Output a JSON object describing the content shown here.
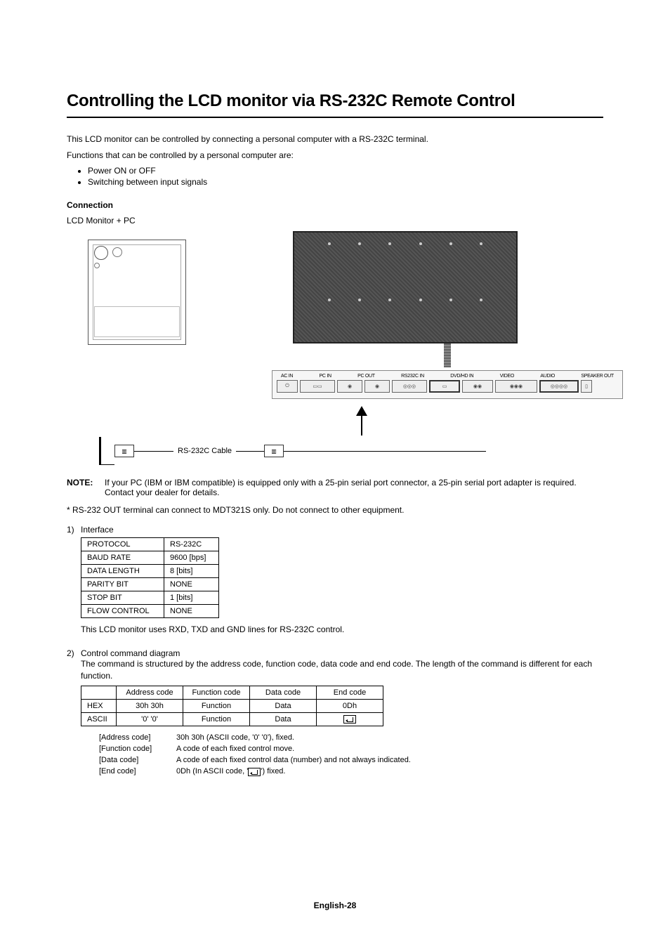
{
  "title": "Controlling the LCD monitor via RS-232C Remote Control",
  "intro1": "This LCD monitor can be controlled by connecting a personal computer with a RS-232C terminal.",
  "intro2": "Functions that can be controlled by a personal computer are:",
  "bullets": [
    "Power ON or OFF",
    "Switching between input signals"
  ],
  "connection": {
    "heading": "Connection",
    "subtitle": "LCD Monitor + PC",
    "cable_label": "RS-232C Cable",
    "panel_labels": [
      "AC IN",
      "PC IN",
      "PC OUT",
      "RS232C IN",
      "DVD/HD IN",
      "VIDEO",
      "AUDIO",
      "SPEAKER OUT"
    ]
  },
  "note": {
    "label": "NOTE:",
    "text": "If your PC (IBM or IBM compatible) is equipped only with a 25-pin serial port connector, a 25-pin serial port adapter is required. Contact your dealer for details."
  },
  "asterisk": "* RS-232 OUT terminal can connect to MDT321S only. Do not connect to other equipment.",
  "interface": {
    "num": "1)",
    "label": "Interface",
    "rows": [
      [
        "PROTOCOL",
        "RS-232C"
      ],
      [
        "BAUD RATE",
        "9600 [bps]"
      ],
      [
        "DATA LENGTH",
        "8 [bits]"
      ],
      [
        "PARITY BIT",
        "NONE"
      ],
      [
        "STOP BIT",
        "1 [bits]"
      ],
      [
        "FLOW CONTROL",
        "NONE"
      ]
    ],
    "after": "This LCD monitor uses RXD, TXD and GND lines for RS-232C control."
  },
  "command": {
    "num": "2)",
    "label": "Control command diagram",
    "desc": "The command is structured by the address code, function code, data code and end code. The length of the command is different for each function.",
    "headers": [
      "",
      "Address code",
      "Function code",
      "Data code",
      "End code"
    ],
    "rows": [
      [
        "HEX",
        "30h 30h",
        "Function",
        "Data",
        "0Dh"
      ],
      [
        "ASCII",
        "'0' '0'",
        "Function",
        "Data",
        "__ENTER__"
      ]
    ],
    "defs": [
      [
        "[Address code]",
        "30h 30h (ASCII code, '0' '0'), fixed."
      ],
      [
        "[Function code]",
        "A code of each fixed control move."
      ],
      [
        "[Data code]",
        "A code of each fixed control data (number) and not always indicated."
      ],
      [
        "[End code]",
        "0Dh (In ASCII code, '__ENTER__') fixed."
      ]
    ]
  },
  "footer": "English-28"
}
